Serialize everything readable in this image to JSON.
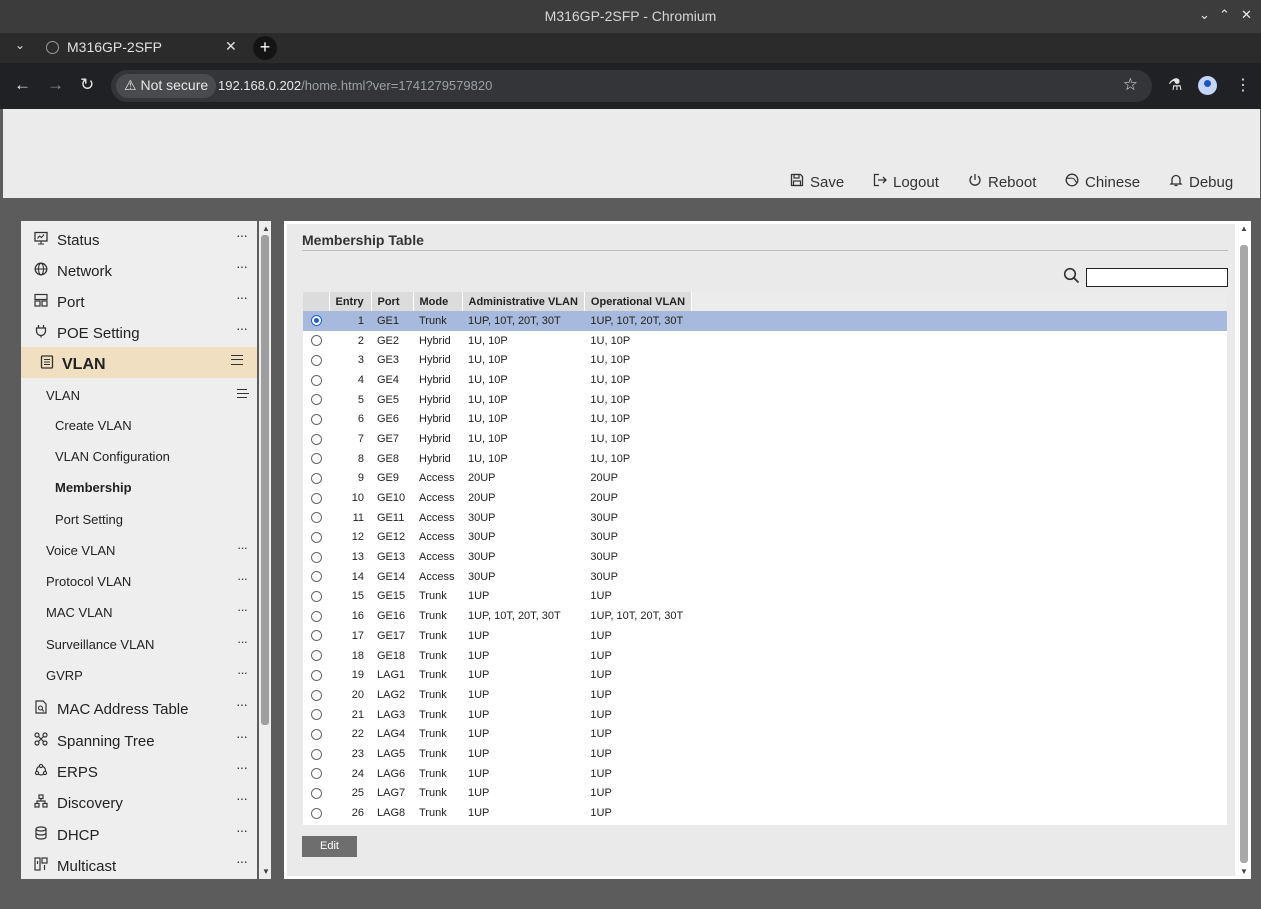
{
  "window": {
    "title": "M316GP-2SFP - Chromium",
    "controls": [
      "⌄",
      "⌃",
      "✕"
    ]
  },
  "browser": {
    "tab_title": "M316GP-2SFP",
    "security_label": "Not secure",
    "url_host": "192.168.0.202",
    "url_path": "/home.html?ver=1741279579820"
  },
  "header": {
    "buttons": [
      {
        "label": "Save",
        "icon": "save-icon"
      },
      {
        "label": "Logout",
        "icon": "logout-icon"
      },
      {
        "label": "Reboot",
        "icon": "power-icon"
      },
      {
        "label": "Chinese",
        "icon": "language-icon"
      },
      {
        "label": "Debug",
        "icon": "bell-icon"
      }
    ]
  },
  "sidebar": {
    "items": [
      {
        "label": "Status",
        "icon": "monitor-icon"
      },
      {
        "label": "Network",
        "icon": "globe-icon"
      },
      {
        "label": "Port",
        "icon": "port-icon"
      },
      {
        "label": "POE Setting",
        "icon": "plug-icon"
      },
      {
        "label": "VLAN",
        "icon": "list-icon",
        "active": true
      },
      {
        "label": "MAC Address Table",
        "icon": "doc-search-icon"
      },
      {
        "label": "Spanning Tree",
        "icon": "tree-icon"
      },
      {
        "label": "ERPS",
        "icon": "ring-icon"
      },
      {
        "label": "Discovery",
        "icon": "hierarchy-icon"
      },
      {
        "label": "DHCP",
        "icon": "database-icon"
      },
      {
        "label": "Multicast",
        "icon": "multicast-icon"
      }
    ],
    "vlan_sub": {
      "label": "VLAN",
      "children": [
        "Create VLAN",
        "VLAN Configuration",
        "Membership",
        "Port Setting"
      ],
      "active_child": "Membership"
    },
    "sub_items": [
      "Voice VLAN",
      "Protocol VLAN",
      "MAC VLAN",
      "Surveillance VLAN",
      "GVRP"
    ]
  },
  "main": {
    "title": "Membership Table",
    "search_value": "",
    "edit_label": "Edit",
    "columns": [
      "Entry",
      "Port",
      "Mode",
      "Administrative VLAN",
      "Operational VLAN"
    ],
    "selected_entry": 1,
    "rows": [
      {
        "entry": 1,
        "port": "GE1",
        "mode": "Trunk",
        "admin": "1UP, 10T, 20T, 30T",
        "oper": "1UP, 10T, 20T, 30T"
      },
      {
        "entry": 2,
        "port": "GE2",
        "mode": "Hybrid",
        "admin": "1U, 10P",
        "oper": "1U, 10P"
      },
      {
        "entry": 3,
        "port": "GE3",
        "mode": "Hybrid",
        "admin": "1U, 10P",
        "oper": "1U, 10P"
      },
      {
        "entry": 4,
        "port": "GE4",
        "mode": "Hybrid",
        "admin": "1U, 10P",
        "oper": "1U, 10P"
      },
      {
        "entry": 5,
        "port": "GE5",
        "mode": "Hybrid",
        "admin": "1U, 10P",
        "oper": "1U, 10P"
      },
      {
        "entry": 6,
        "port": "GE6",
        "mode": "Hybrid",
        "admin": "1U, 10P",
        "oper": "1U, 10P"
      },
      {
        "entry": 7,
        "port": "GE7",
        "mode": "Hybrid",
        "admin": "1U, 10P",
        "oper": "1U, 10P"
      },
      {
        "entry": 8,
        "port": "GE8",
        "mode": "Hybrid",
        "admin": "1U, 10P",
        "oper": "1U, 10P"
      },
      {
        "entry": 9,
        "port": "GE9",
        "mode": "Access",
        "admin": "20UP",
        "oper": "20UP"
      },
      {
        "entry": 10,
        "port": "GE10",
        "mode": "Access",
        "admin": "20UP",
        "oper": "20UP"
      },
      {
        "entry": 11,
        "port": "GE11",
        "mode": "Access",
        "admin": "30UP",
        "oper": "30UP"
      },
      {
        "entry": 12,
        "port": "GE12",
        "mode": "Access",
        "admin": "30UP",
        "oper": "30UP"
      },
      {
        "entry": 13,
        "port": "GE13",
        "mode": "Access",
        "admin": "30UP",
        "oper": "30UP"
      },
      {
        "entry": 14,
        "port": "GE14",
        "mode": "Access",
        "admin": "30UP",
        "oper": "30UP"
      },
      {
        "entry": 15,
        "port": "GE15",
        "mode": "Trunk",
        "admin": "1UP",
        "oper": "1UP"
      },
      {
        "entry": 16,
        "port": "GE16",
        "mode": "Trunk",
        "admin": "1UP, 10T, 20T, 30T",
        "oper": "1UP, 10T, 20T, 30T"
      },
      {
        "entry": 17,
        "port": "GE17",
        "mode": "Trunk",
        "admin": "1UP",
        "oper": "1UP"
      },
      {
        "entry": 18,
        "port": "GE18",
        "mode": "Trunk",
        "admin": "1UP",
        "oper": "1UP"
      },
      {
        "entry": 19,
        "port": "LAG1",
        "mode": "Trunk",
        "admin": "1UP",
        "oper": "1UP"
      },
      {
        "entry": 20,
        "port": "LAG2",
        "mode": "Trunk",
        "admin": "1UP",
        "oper": "1UP"
      },
      {
        "entry": 21,
        "port": "LAG3",
        "mode": "Trunk",
        "admin": "1UP",
        "oper": "1UP"
      },
      {
        "entry": 22,
        "port": "LAG4",
        "mode": "Trunk",
        "admin": "1UP",
        "oper": "1UP"
      },
      {
        "entry": 23,
        "port": "LAG5",
        "mode": "Trunk",
        "admin": "1UP",
        "oper": "1UP"
      },
      {
        "entry": 24,
        "port": "LAG6",
        "mode": "Trunk",
        "admin": "1UP",
        "oper": "1UP"
      },
      {
        "entry": 25,
        "port": "LAG7",
        "mode": "Trunk",
        "admin": "1UP",
        "oper": "1UP"
      },
      {
        "entry": 26,
        "port": "LAG8",
        "mode": "Trunk",
        "admin": "1UP",
        "oper": "1UP"
      }
    ]
  },
  "colors": {
    "selected_row": "#a7b9dc",
    "active_menu": "#f0dfc0",
    "edit_button": "#6e6e6e"
  }
}
